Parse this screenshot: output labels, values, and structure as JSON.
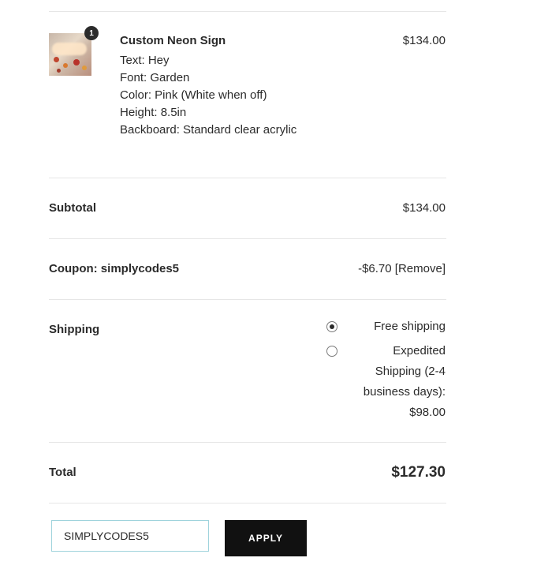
{
  "cart_item": {
    "quantity": "1",
    "name": "Custom Neon Sign",
    "price": "$134.00",
    "meta": [
      "Text: Hey",
      "Font: Garden",
      "Color: Pink (White when off)",
      "Height: 8.5in",
      "Backboard: Standard clear acrylic"
    ]
  },
  "subtotal": {
    "label": "Subtotal",
    "value": "$134.00"
  },
  "coupon": {
    "label": "Coupon: simplycodes5",
    "amount": "-$6.70",
    "remove_label": "[Remove]"
  },
  "shipping": {
    "label": "Shipping",
    "options": [
      {
        "lines": [
          "Free shipping"
        ],
        "selected": true
      },
      {
        "lines": [
          "Expedited",
          "Shipping (2-4",
          "business days):",
          "$98.00"
        ],
        "selected": false
      }
    ]
  },
  "total": {
    "label": "Total",
    "value": "$127.30"
  },
  "coupon_form": {
    "input_value": "SIMPLYCODES5",
    "apply_label": "APPLY"
  }
}
